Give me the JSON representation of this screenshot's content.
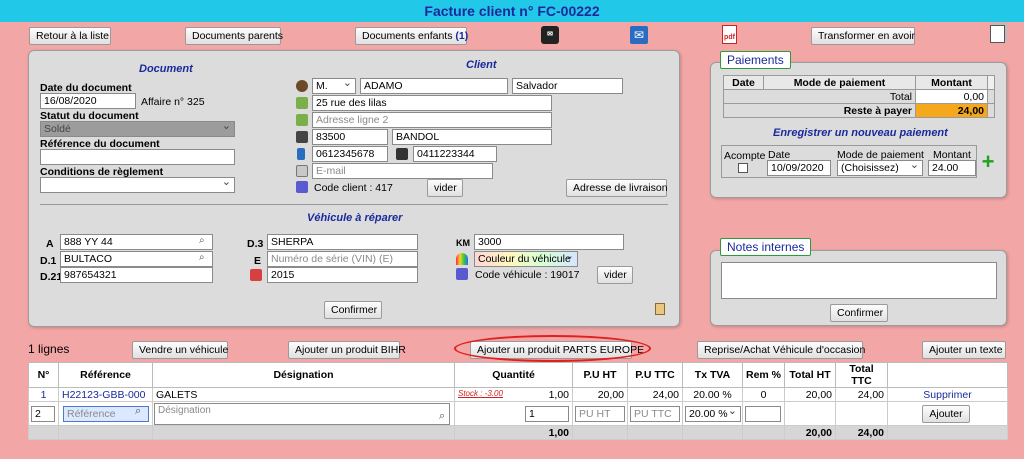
{
  "header": {
    "title": "Facture client n° FC-00222"
  },
  "toolbar": {
    "back": "Retour à la liste",
    "parents": "Documents parents",
    "children": "Documents enfants",
    "children_count": "(1)",
    "transform": "Transformer en avoir"
  },
  "document": {
    "title": "Document",
    "date_label": "Date du document",
    "date": "16/08/2020",
    "affaire": "Affaire n° 325",
    "status_label": "Statut du document",
    "status": "Soldé",
    "ref_label": "Référence du document",
    "ref": "",
    "cond_label": "Conditions de règlement",
    "cond": ""
  },
  "client": {
    "title": "Client",
    "civility": "M.",
    "lastname": "ADAMO",
    "firstname": "Salvador",
    "address1": "25 rue des lilas",
    "address2_ph": "Adresse ligne 2",
    "zip": "83500",
    "city": "BANDOL",
    "mobile": "0612345678",
    "phone": "0411223344",
    "email_ph": "E-mail",
    "code": "Code client : 417",
    "clear": "vider",
    "delivery": "Adresse de livraison"
  },
  "vehicle": {
    "title": "Véhicule à réparer",
    "a_label": "A",
    "a": "888 YY 44",
    "d1_label": "D.1",
    "d1": "BULTACO",
    "d21_label": "D.21",
    "d21": "987654321",
    "d3_label": "D.3",
    "d3": "SHERPA",
    "e_label": "E",
    "vin_ph": "Numéro de série (VIN) (E)",
    "year": "2015",
    "km_label": "KM",
    "km": "3000",
    "color": "Couleur du véhicule",
    "code": "Code véhicule : 19017",
    "clear": "vider",
    "confirm": "Confirmer"
  },
  "payments": {
    "title": "Paiements",
    "headers": [
      "Date",
      "Mode de paiement",
      "Montant"
    ],
    "total_label": "Total",
    "total": "0,00",
    "remaining_label": "Reste à payer",
    "remaining": "24,00",
    "new_title": "Enregistrer un nouveau paiement",
    "form_headers": [
      "Acompte",
      "Date",
      "Mode de paiement",
      "Montant"
    ],
    "date": "10/09/2020",
    "mode": "(Choisissez)",
    "amount": "24.00",
    "add_symbol": "+"
  },
  "notes": {
    "title": "Notes internes",
    "confirm": "Confirmer"
  },
  "lines": {
    "count": "1 lignes",
    "sell_vehicle": "Vendre un véhicule",
    "add_bihr": "Ajouter un produit BIHR",
    "add_parts": "Ajouter un produit PARTS EUROPE",
    "resale": "Reprise/Achat Véhicule d'occasion",
    "add_text": "Ajouter un texte",
    "headers": [
      "N°",
      "Référence",
      "Désignation",
      "Quantité",
      "P.U HT",
      "P.U TTC",
      "Tx TVA",
      "Rem %",
      "Total HT",
      "Total TTC",
      ""
    ],
    "rows": [
      {
        "n": "1",
        "ref": "H22123-GBB-000",
        "designation": "GALETS",
        "stock": "Stock : -3.00",
        "qty": "1,00",
        "pu_ht": "20,00",
        "pu_ttc": "24,00",
        "tva": "20.00 %",
        "rem": "0",
        "total_ht": "20,00",
        "total_ttc": "24,00",
        "action": "Supprimer"
      }
    ],
    "new_n": "2",
    "ref_ph": "Référence",
    "designation_ph": "Désignation",
    "new_qty": "1",
    "pu_ht_ph": "PU HT",
    "pu_ttc_ph": "PU TTC",
    "new_tva": "20.00 %",
    "add_btn": "Ajouter",
    "footer": {
      "qty": "1,00",
      "total_ht": "20,00",
      "total_ttc": "24,00"
    }
  },
  "colors": {
    "accent_bar": "#22c8e8",
    "background": "#f3a6a6",
    "remaining_bg": "#f5a81c",
    "highlight": "#e02020"
  }
}
